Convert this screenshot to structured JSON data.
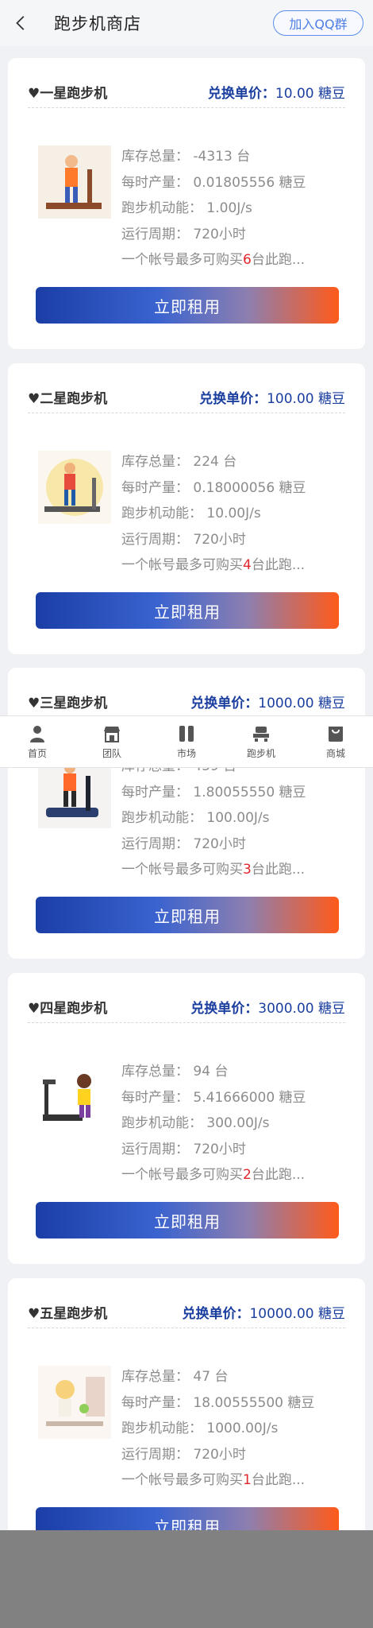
{
  "header": {
    "back": "back",
    "title": "跑步机商店",
    "qq_button": "加入QQ群"
  },
  "labels": {
    "price_prefix": "兑换单价：",
    "stock": "库存总量：",
    "hourly": "每时产量：",
    "power": "跑步机动能：",
    "cycle": "运行周期：",
    "limit_prefix": "一个帐号最多可购买",
    "limit_suffix": "台此跑...",
    "rent": "立即租用"
  },
  "cards": [
    {
      "name": "♥一星跑步机",
      "price": "10.00 糖豆",
      "stock": "-4313 台",
      "hourly": "0.01805556 糖豆",
      "power": "1.00J/s",
      "cycle": "720小时",
      "limit": "6"
    },
    {
      "name": "♥二星跑步机",
      "price": "100.00 糖豆",
      "stock": "224 台",
      "hourly": "0.18000056 糖豆",
      "power": "10.00J/s",
      "cycle": "720小时",
      "limit": "4"
    },
    {
      "name": "♥三星跑步机",
      "price": "1000.00 糖豆",
      "stock": "459 台",
      "hourly": "1.80055550 糖豆",
      "power": "100.00J/s",
      "cycle": "720小时",
      "limit": "3"
    },
    {
      "name": "♥四星跑步机",
      "price": "3000.00 糖豆",
      "stock": "94 台",
      "hourly": "5.41666000 糖豆",
      "power": "300.00J/s",
      "cycle": "720小时",
      "limit": "2"
    },
    {
      "name": "♥五星跑步机",
      "price": "10000.00 糖豆",
      "stock": "47 台",
      "hourly": "18.00555500 糖豆",
      "power": "1000.00J/s",
      "cycle": "720小时",
      "limit": "1"
    }
  ],
  "nav": [
    {
      "label": "首页",
      "icon": "person-icon"
    },
    {
      "label": "团队",
      "icon": "store-icon"
    },
    {
      "label": "市场",
      "icon": "market-icon"
    },
    {
      "label": "跑步机",
      "icon": "treadmill-icon"
    },
    {
      "label": "商城",
      "icon": "shopping-bag-icon"
    }
  ]
}
